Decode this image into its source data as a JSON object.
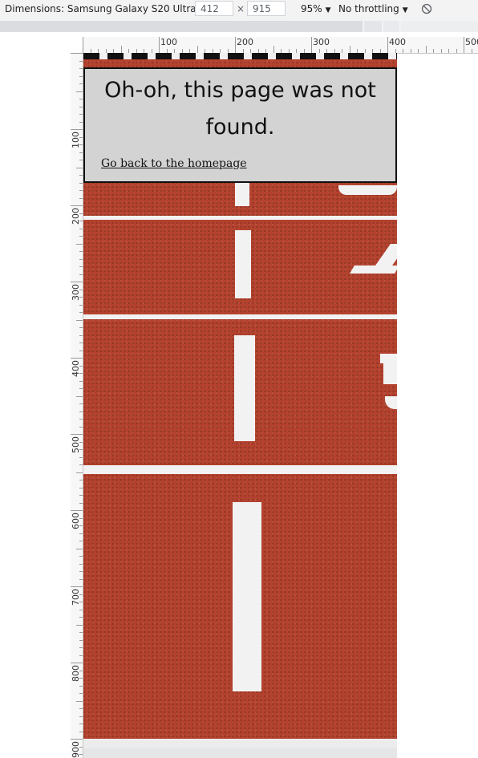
{
  "toolbar": {
    "device": "Dimensions: Samsung Galaxy S20 Ultra",
    "width": "412",
    "times": "×",
    "height": "915",
    "zoom": "95%",
    "throttling": "No throttling",
    "rotate_icon": "rotate-icon"
  },
  "ruler": {
    "h_labels": [
      "100",
      "200",
      "300",
      "400",
      "500"
    ],
    "v_labels": [
      "100",
      "200",
      "300",
      "400",
      "500",
      "600",
      "700",
      "800",
      "900"
    ]
  },
  "page": {
    "heading": "Oh-oh, this page was not found.",
    "link": "Go back to the homepage",
    "background": "running-track-photo",
    "colors": {
      "track": "#b4422e",
      "card": "#d3d3d3",
      "lines": "#f2f2f2"
    }
  }
}
